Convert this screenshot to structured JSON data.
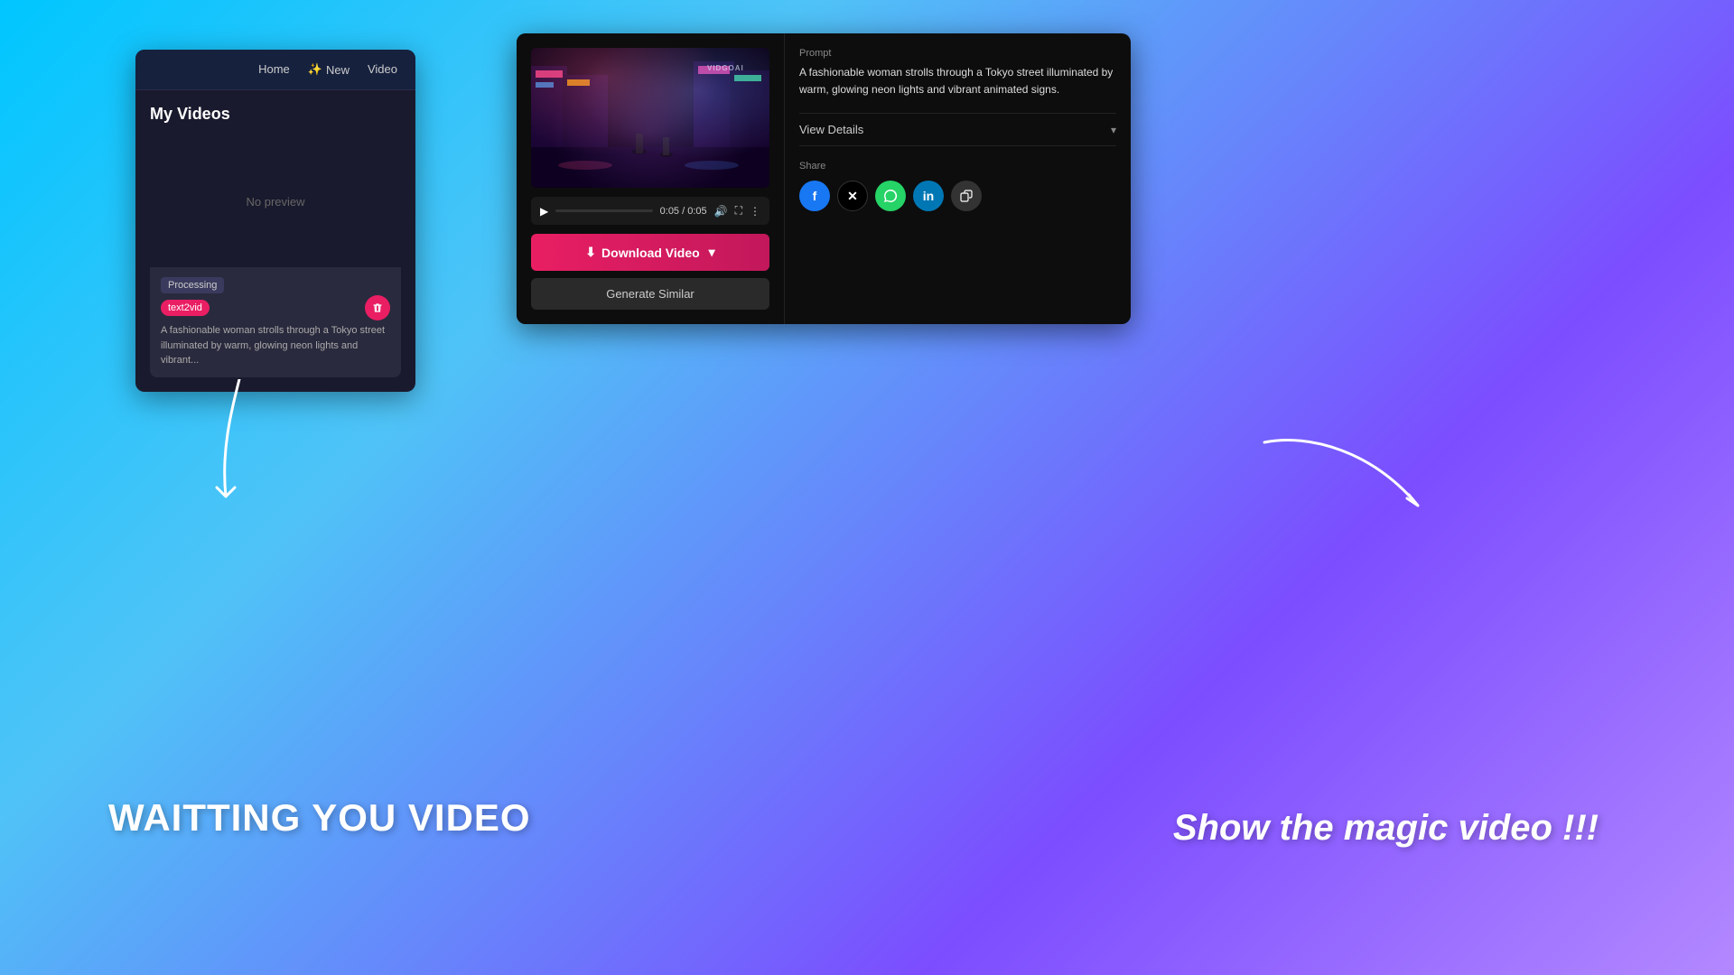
{
  "background": {
    "gradient_start": "#00c6ff",
    "gradient_end": "#b388ff"
  },
  "left_panel": {
    "nav": {
      "home": "Home",
      "new": "New",
      "new_icon": "sparkle-icon",
      "video": "Video"
    },
    "title": "My Videos",
    "video_card": {
      "preview_text": "No preview",
      "processing_badge": "Processing",
      "tag_badge": "text2vid",
      "description": "A fashionable woman strolls through a Tokyo street illuminated by warm, glowing neon lights and vibrant..."
    }
  },
  "right_panel": {
    "prompt_label": "Prompt",
    "prompt_text": "A fashionable woman strolls through a Tokyo street illuminated by warm, glowing neon lights and vibrant animated signs.",
    "view_details": "View Details",
    "share_label": "Share",
    "video_controls": {
      "time": "0:05 / 0:05"
    },
    "download_button": "Download Video",
    "generate_similar_button": "Generate Similar",
    "watermark": "VIDGOAI"
  },
  "annotations": {
    "left_text": "WAITTING YOU VIDEO",
    "right_text": "Show the magic video !!!"
  }
}
